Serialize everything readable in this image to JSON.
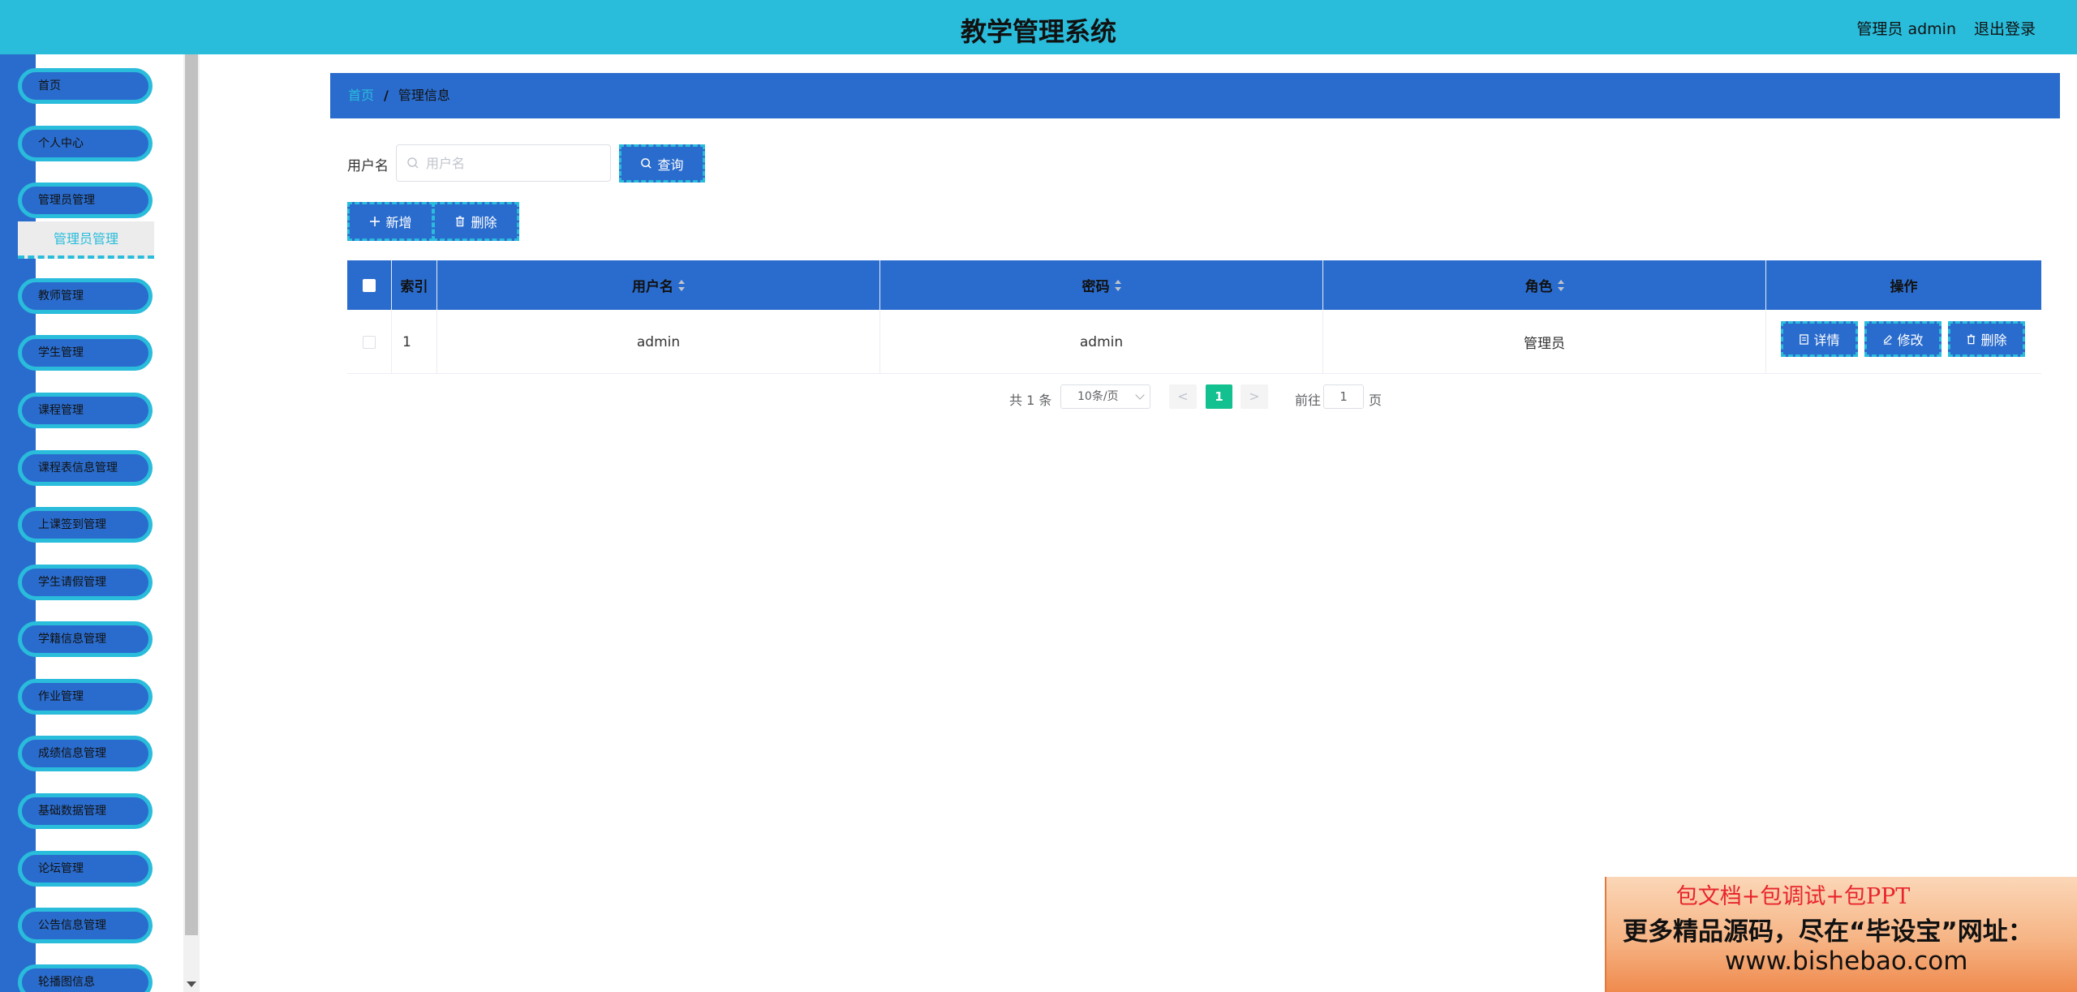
{
  "header": {
    "title": "教学管理系统",
    "user": "管理员 admin",
    "logout": "退出登录"
  },
  "sidebar": {
    "items": [
      {
        "label": "首页"
      },
      {
        "label": "个人中心"
      },
      {
        "label": "管理员管理"
      },
      {
        "label": "教师管理"
      },
      {
        "label": "学生管理"
      },
      {
        "label": "课程管理"
      },
      {
        "label": "课程表信息管理"
      },
      {
        "label": "上课签到管理"
      },
      {
        "label": "学生请假管理"
      },
      {
        "label": "学籍信息管理"
      },
      {
        "label": "作业管理"
      },
      {
        "label": "成绩信息管理"
      },
      {
        "label": "基础数据管理"
      },
      {
        "label": "论坛管理"
      },
      {
        "label": "公告信息管理"
      },
      {
        "label": "轮播图信息"
      }
    ],
    "submenu": {
      "label": "管理员管理"
    }
  },
  "breadcrumb": {
    "home": "首页",
    "separator": "/",
    "current": "管理信息"
  },
  "search": {
    "label": "用户名",
    "placeholder": "用户名",
    "button": "查询"
  },
  "toolbar": {
    "add": "新增",
    "delete": "删除"
  },
  "table": {
    "columns": {
      "index": "索引",
      "username": "用户名",
      "password": "密码",
      "role": "角色",
      "actions": "操作"
    },
    "rows": [
      {
        "index": "1",
        "username": "admin",
        "password": "admin",
        "role": "管理员"
      }
    ],
    "row_actions": {
      "detail": "详情",
      "edit": "修改",
      "delete": "删除"
    }
  },
  "pagination": {
    "total": "共 1 条",
    "page_size": "10条/页",
    "prev": "<",
    "current": "1",
    "next": ">",
    "goto_label": "前往",
    "goto_value": "1",
    "goto_unit": "页"
  },
  "ad": {
    "line1": "包文档+包调试+包PPT",
    "line2": "更多精品源码，尽在“毕设宝”网址：",
    "line3": "www.bishebao.com"
  },
  "colors": {
    "header": "#29bcdb",
    "primary": "#2a6ccd",
    "accent": "#29bcdb",
    "page_active": "#13c08f"
  }
}
